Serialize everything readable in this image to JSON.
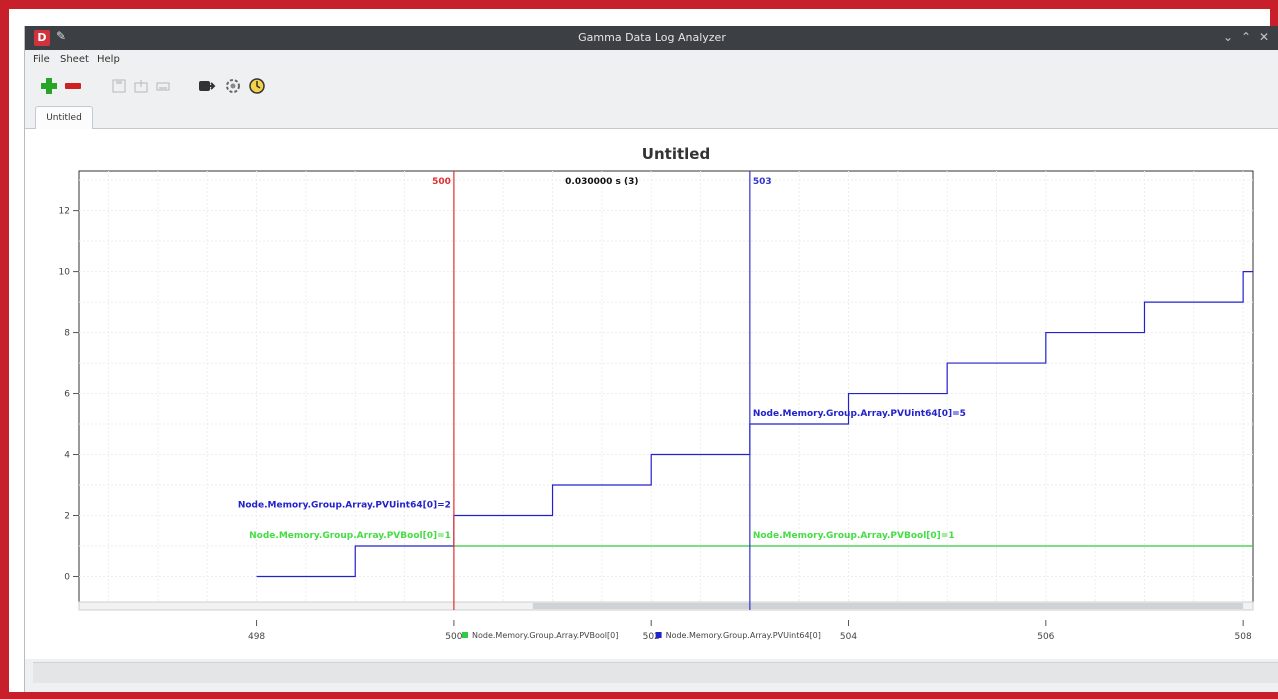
{
  "window": {
    "title": "Gamma Data Log Analyzer"
  },
  "menu": {
    "items": [
      "File",
      "Sheet",
      "Help"
    ]
  },
  "toolbar": {
    "buttons": [
      "add-icon",
      "remove-icon",
      "save-icon",
      "export-icon",
      "print-icon",
      "export-arrow-icon",
      "settings-icon",
      "timer-icon"
    ]
  },
  "tabs": [
    {
      "label": "Untitled"
    }
  ],
  "chart_data": {
    "type": "line",
    "title": "Untitled",
    "xlim": [
      496.2,
      508.1
    ],
    "ylim": [
      -1.1,
      13.3
    ],
    "x_ticks": [
      498,
      500,
      502,
      504,
      506,
      508
    ],
    "y_ticks": [
      0,
      2,
      4,
      6,
      8,
      10,
      12
    ],
    "grid": true,
    "legend_position": "bottom",
    "series": [
      {
        "name": "Node.Memory.Group.Array.PVBool[0]",
        "color": "#2ecc40",
        "step": true,
        "x": [
          500,
          508.1
        ],
        "y": [
          1,
          1
        ]
      },
      {
        "name": "Node.Memory.Group.Array.PVUint64[0]",
        "color": "#2222cc",
        "step": true,
        "x": [
          498,
          499,
          500,
          501,
          502,
          503,
          504,
          505,
          506,
          507,
          508,
          508.1
        ],
        "y": [
          0,
          1,
          2,
          3,
          4,
          5,
          6,
          7,
          8,
          9,
          10,
          10
        ]
      }
    ],
    "cursors": [
      {
        "x": 500,
        "label": "500",
        "color": "#e03030"
      },
      {
        "x": 503,
        "label": "503",
        "color": "#3333cc"
      }
    ],
    "cursor_delta_label": "0.030000 s (3)",
    "annotations": [
      {
        "text": "Node.Memory.Group.Array.PVUint64[0]=2",
        "color": "#2222cc",
        "anchor": "left-of-cursor",
        "cursor": 0,
        "y": 2
      },
      {
        "text": "Node.Memory.Group.Array.PVBool[0]=1",
        "color": "#44dd44",
        "anchor": "left-of-cursor",
        "cursor": 0,
        "y": 1
      },
      {
        "text": "Node.Memory.Group.Array.PVUint64[0]=5",
        "color": "#2222cc",
        "anchor": "right-of-cursor",
        "cursor": 1,
        "y": 5
      },
      {
        "text": "Node.Memory.Group.Array.PVBool[0]=1",
        "color": "#44dd44",
        "anchor": "right-of-cursor",
        "cursor": 1,
        "y": 1
      }
    ],
    "legend": [
      {
        "label": "Node.Memory.Group.Array.PVBool[0]",
        "color": "#2ecc40"
      },
      {
        "label": "Node.Memory.Group.Array.PVUint64[0]",
        "color": "#2222cc"
      }
    ]
  }
}
